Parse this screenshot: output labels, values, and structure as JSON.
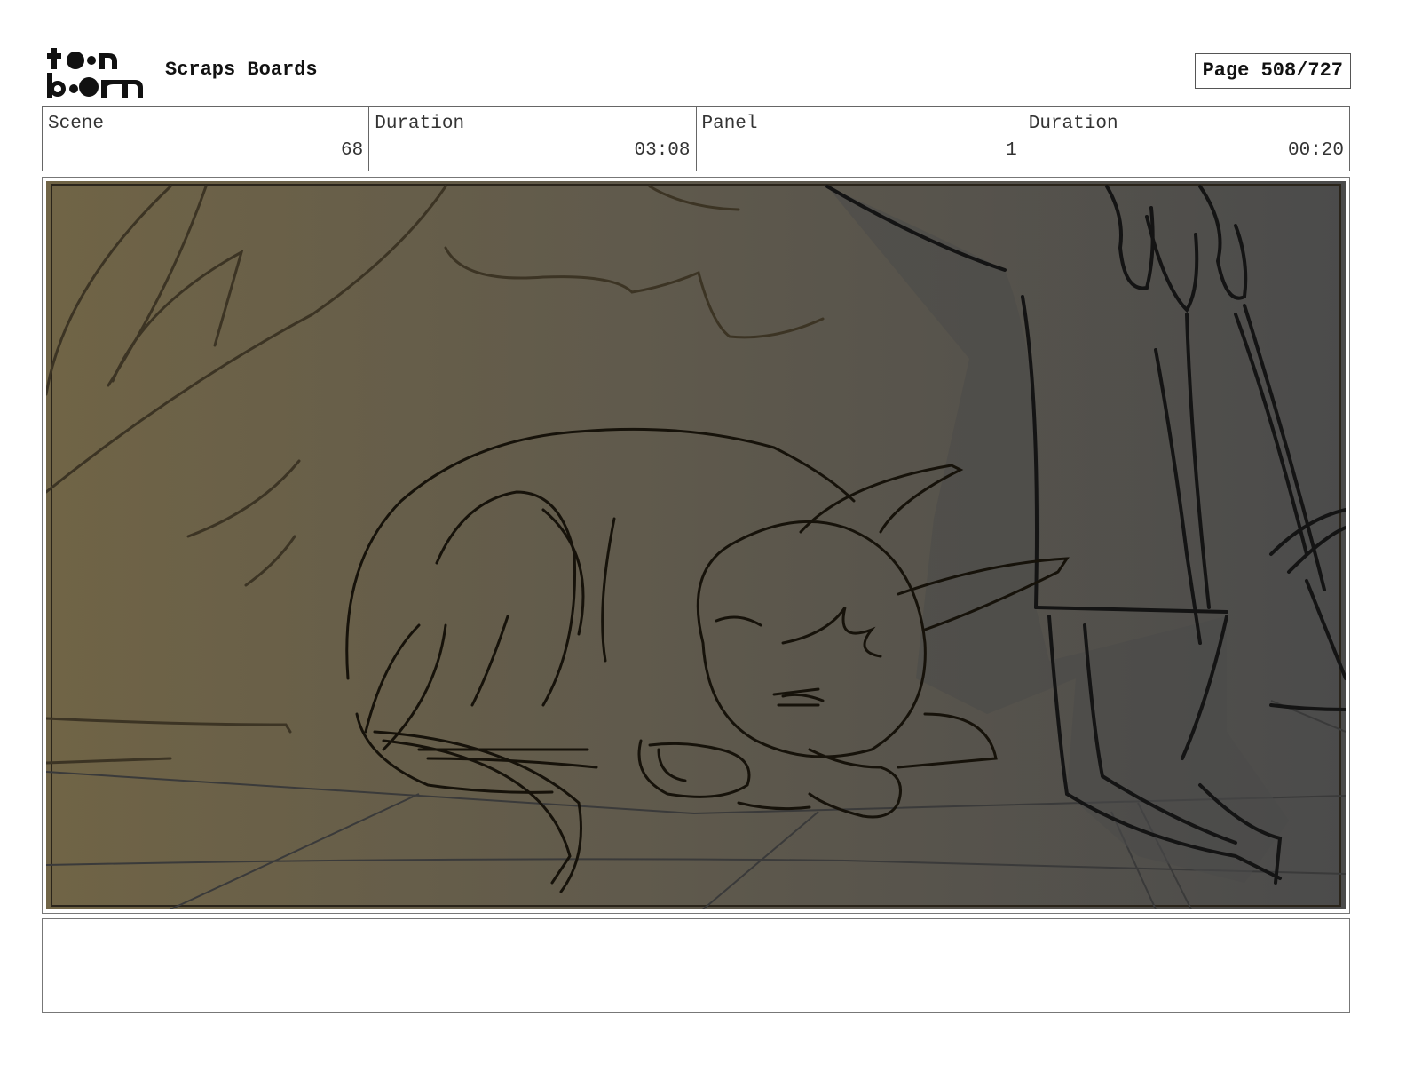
{
  "header": {
    "logo_line1": "t●●n",
    "logo_line2": "b●●m",
    "title": "Scraps Boards",
    "page_label": "Page 508/727"
  },
  "info": {
    "scene_label": "Scene",
    "scene_value": "68",
    "scene_duration_label": "Duration",
    "scene_duration_value": "03:08",
    "panel_label": "Panel",
    "panel_value": "1",
    "panel_duration_label": "Duration",
    "panel_duration_value": "00:20"
  },
  "notes": {
    "text": ""
  },
  "colors": {
    "sketch_left": "#6f6244",
    "sketch_mid": "#5d5a50",
    "sketch_right": "#4a4a4a",
    "line": "#1a150c"
  }
}
